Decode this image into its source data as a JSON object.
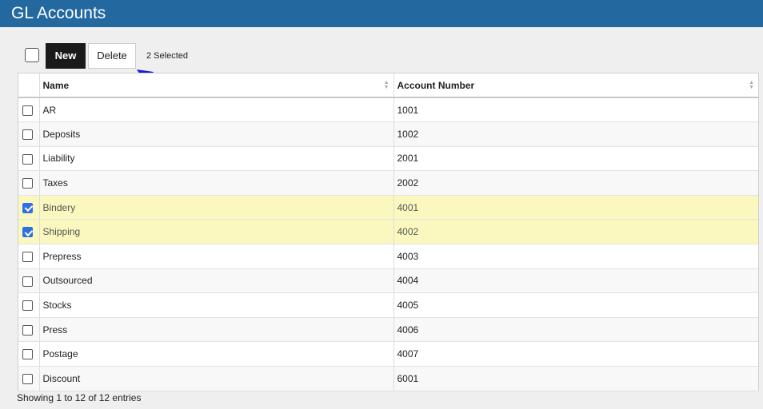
{
  "header": {
    "title": "GL Accounts"
  },
  "toolbar": {
    "new_label": "New",
    "delete_label": "Delete",
    "selected_text": "2 Selected"
  },
  "table": {
    "columns": [
      "Name",
      "Account Number"
    ],
    "rows": [
      {
        "name": "AR",
        "number": "1001",
        "checked": false
      },
      {
        "name": "Deposits",
        "number": "1002",
        "checked": false
      },
      {
        "name": "Liability",
        "number": "2001",
        "checked": false
      },
      {
        "name": "Taxes",
        "number": "2002",
        "checked": false
      },
      {
        "name": "Bindery",
        "number": "4001",
        "checked": true
      },
      {
        "name": "Shipping",
        "number": "4002",
        "checked": true
      },
      {
        "name": "Prepress",
        "number": "4003",
        "checked": false
      },
      {
        "name": "Outsourced",
        "number": "4004",
        "checked": false
      },
      {
        "name": "Stocks",
        "number": "4005",
        "checked": false
      },
      {
        "name": "Press",
        "number": "4006",
        "checked": false
      },
      {
        "name": "Postage",
        "number": "4007",
        "checked": false
      },
      {
        "name": "Discount",
        "number": "6001",
        "checked": false
      }
    ]
  },
  "footer": {
    "info": "Showing 1 to 12 of 12 entries"
  },
  "colors": {
    "header_bg": "#2468a0",
    "selected_row_bg": "#fbf8bf",
    "annotation_arrow": "#1a1adb",
    "checkbox_checked": "#2d6fe6"
  }
}
